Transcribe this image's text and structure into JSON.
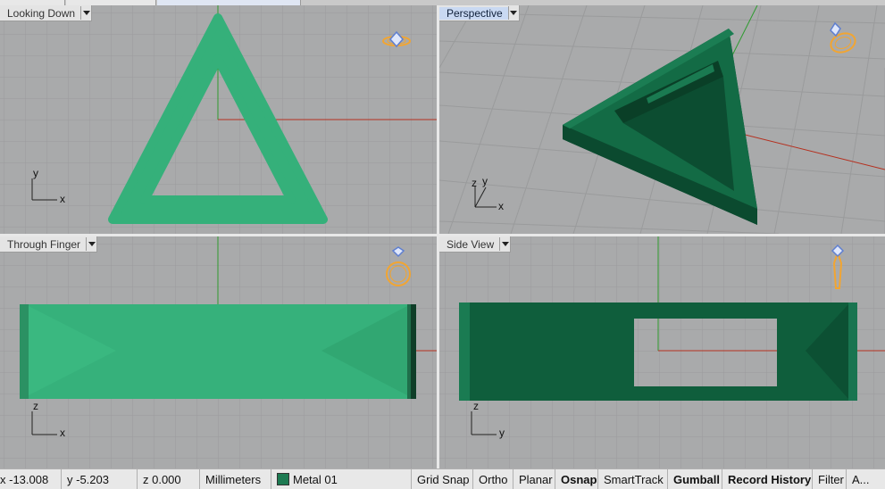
{
  "viewports": {
    "top": {
      "label": "Looking Down"
    },
    "perspective": {
      "label": "Perspective"
    },
    "front": {
      "label": "Through Finger"
    },
    "right": {
      "label": "Side View"
    }
  },
  "axes": {
    "x": "x",
    "y": "y",
    "z": "z"
  },
  "status": {
    "x": "x -13.008",
    "y": "y -5.203",
    "z": "z 0.000",
    "units": "Millimeters",
    "layer": "Metal 01",
    "grid_snap": "Grid Snap",
    "ortho": "Ortho",
    "planar": "Planar",
    "osnap": "Osnap",
    "smarttrack": "SmartTrack",
    "gumball": "Gumball",
    "record_history": "Record History",
    "filter": "Filter",
    "more": "A..."
  },
  "colors": {
    "viewport_bg": "#a9aaab",
    "grid": "#9a9b9c",
    "x_axis": "#b5301f",
    "y_axis": "#2e9a2e",
    "object_light": "#35b07a",
    "object_dark": "#0f5e3c",
    "icon_gold": "#f2a531",
    "icon_blue": "#5f7fd0",
    "layer_swatch": "#1d7a52"
  },
  "icons": [
    "ring-top-icon",
    "ring-perspective-icon",
    "ring-front-icon",
    "ring-side-icon",
    "dropdown-arrow-icon"
  ]
}
